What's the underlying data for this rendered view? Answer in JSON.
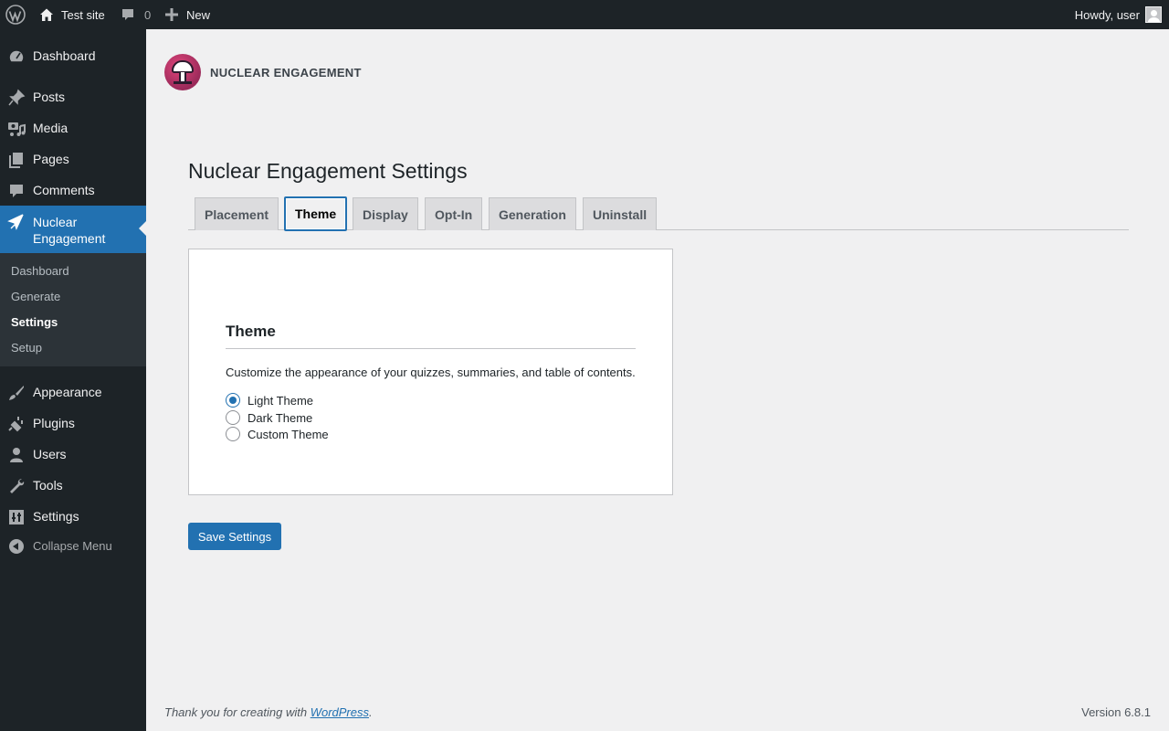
{
  "admin_bar": {
    "site_name": "Test site",
    "comments_count": "0",
    "new_label": "New",
    "howdy": "Howdy, user"
  },
  "sidebar": {
    "items": [
      {
        "label": "Dashboard",
        "icon": "dashboard-icon"
      },
      {
        "label": "Posts",
        "icon": "pin-icon"
      },
      {
        "label": "Media",
        "icon": "media-icon"
      },
      {
        "label": "Pages",
        "icon": "pages-icon"
      },
      {
        "label": "Comments",
        "icon": "comment-icon"
      },
      {
        "label": "Nuclear Engagement",
        "icon": "plane-icon"
      },
      {
        "label": "Appearance",
        "icon": "brush-icon"
      },
      {
        "label": "Plugins",
        "icon": "plug-icon"
      },
      {
        "label": "Users",
        "icon": "user-icon"
      },
      {
        "label": "Tools",
        "icon": "wrench-icon"
      },
      {
        "label": "Settings",
        "icon": "settings-icon"
      }
    ],
    "submenu": [
      {
        "label": "Dashboard"
      },
      {
        "label": "Generate"
      },
      {
        "label": "Settings"
      },
      {
        "label": "Setup"
      }
    ],
    "collapse_label": "Collapse Menu"
  },
  "plugin": {
    "name": "NUCLEAR ENGAGEMENT"
  },
  "page": {
    "title": "Nuclear Engagement Settings",
    "tabs": [
      {
        "label": "Placement"
      },
      {
        "label": "Theme"
      },
      {
        "label": "Display"
      },
      {
        "label": "Opt-In"
      },
      {
        "label": "Generation"
      },
      {
        "label": "Uninstall"
      }
    ],
    "active_tab": "Theme"
  },
  "theme_section": {
    "heading": "Theme",
    "description": "Customize the appearance of your quizzes, summaries, and table of contents.",
    "options": [
      {
        "label": "Light Theme",
        "checked": true
      },
      {
        "label": "Dark Theme",
        "checked": false
      },
      {
        "label": "Custom Theme",
        "checked": false
      }
    ]
  },
  "save_label": "Save Settings",
  "footer": {
    "thanks_prefix": "Thank you for creating with ",
    "thanks_link": "WordPress",
    "thanks_suffix": ".",
    "version": "Version 6.8.1"
  },
  "colors": {
    "accent": "#2271b1",
    "sidebar_bg": "#1d2327",
    "submenu_bg": "#2c3338",
    "page_bg": "#f0f0f1"
  }
}
